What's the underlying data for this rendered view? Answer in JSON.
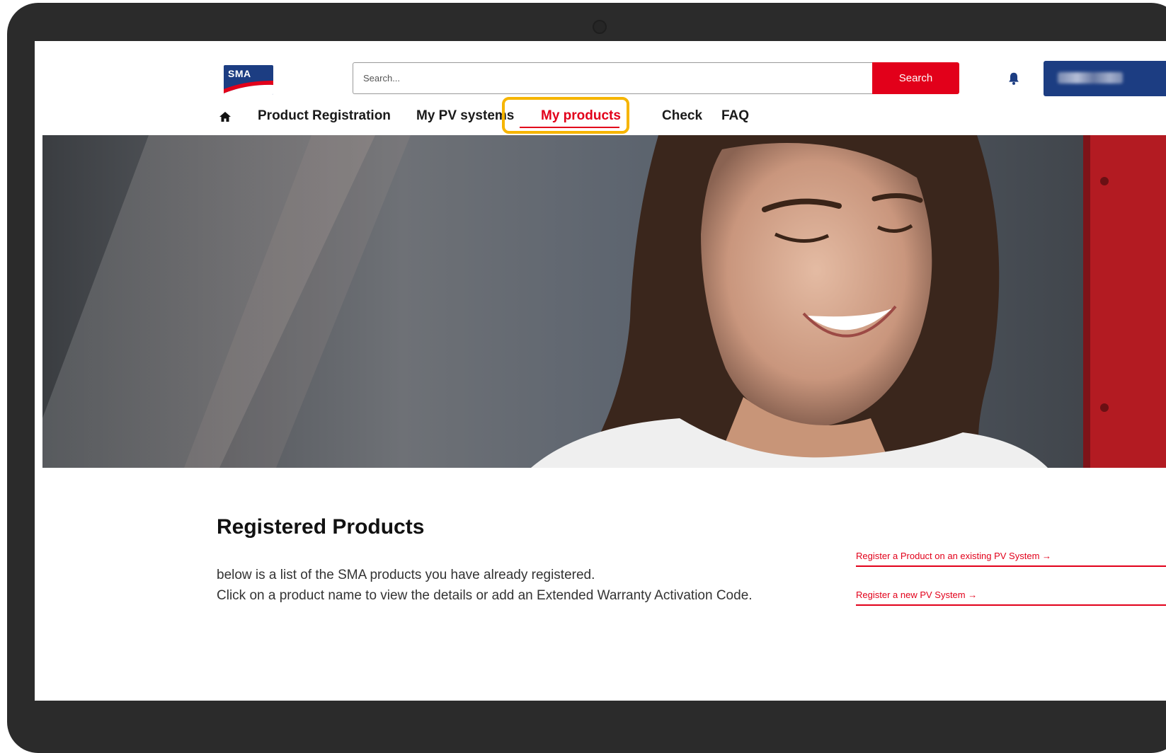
{
  "header": {
    "logo_text": "SMA",
    "search": {
      "placeholder": "Search...",
      "button_label": "Search"
    },
    "icons": {
      "notifications": "bell-icon",
      "home": "home-icon"
    }
  },
  "nav": {
    "items": [
      {
        "label": "Product Registration"
      },
      {
        "label": "My PV systems"
      },
      {
        "label": "My products",
        "active": true
      },
      {
        "label": "Check"
      },
      {
        "label": "FAQ"
      }
    ]
  },
  "main": {
    "title": "Registered Products",
    "description_line1": "below is a list of the SMA products you have already registered.",
    "description_line2": "Click on a product name to view the details or add an Extended Warranty Activation Code.",
    "links": [
      {
        "label": "Register a Product on an existing PV System →"
      },
      {
        "label": "Register a new PV System →"
      }
    ]
  },
  "colors": {
    "brand_red": "#e2001a",
    "brand_blue": "#1c3d82",
    "highlight": "#f6b500"
  }
}
